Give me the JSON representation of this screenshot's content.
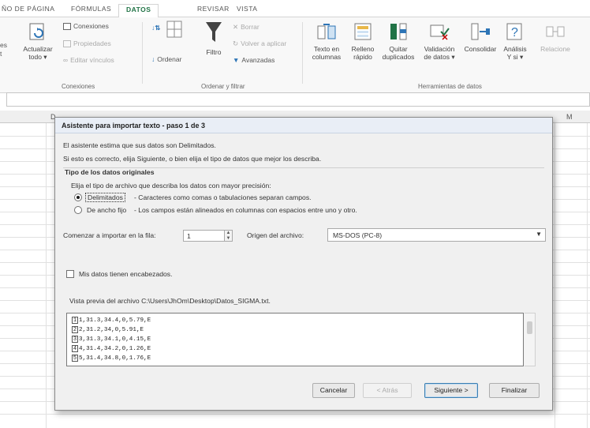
{
  "ribbon_tabs": [
    "ÑO DE PÁGINA",
    "FÓRMULAS",
    "DATOS",
    "REVISAR",
    "VISTA"
  ],
  "ribbon": {
    "edge_left": [
      "es",
      "t"
    ],
    "actualizar": "Actualizar",
    "actualizar_sub": "todo ▾",
    "conexiones": "Conexiones",
    "propiedades": "Propiedades",
    "editar_vinculos": "Editar vínculos",
    "ordenar": "Ordenar",
    "filtro": "Filtro",
    "borrar": "Borrar",
    "volver_aplicar": "Volver a aplicar",
    "avanzadas": "Avanzadas",
    "texto_columnas": [
      "Texto en",
      "columnas"
    ],
    "relleno_rapido": [
      "Relleno",
      "rápido"
    ],
    "quitar_duplicados": [
      "Quitar",
      "duplicados"
    ],
    "validacion_datos": [
      "Validación",
      "de datos ▾"
    ],
    "consolidar": "Consolidar",
    "analisis": [
      "Análisis",
      "Y si ▾"
    ],
    "relaciones": "Relacione",
    "group_conexiones": "Conexiones",
    "group_ordenar": "Ordenar y filtrar",
    "group_herramientas": "Herramientas de datos"
  },
  "sheet": {
    "col_d": "D",
    "col_m": "M"
  },
  "dialog": {
    "title": "Asistente para importar texto - paso 1 de 3",
    "line1": "El asistente estima que sus datos son Delimitados.",
    "line2": "Si esto es correcto, elija Siguiente, o bien elija el tipo de datos que mejor los describa.",
    "section_title": "Tipo de los datos originales",
    "section_prompt": "Elija el tipo de archivo que describa los datos con mayor precisión:",
    "opt_delimitados": "Delimitados",
    "opt_delimitados_desc": "- Caracteres como comas o tabulaciones separan campos.",
    "opt_ancho_fijo": "De ancho fijo",
    "opt_ancho_fijo_desc": "- Los campos están alineados en columnas con espacios entre uno y otro.",
    "start_row_label": "Comenzar a importar en la fila:",
    "start_row_value": "1",
    "origin_label": "Origen del archivo:",
    "origin_value": "MS-DOS (PC-8)",
    "headers_checkbox": "Mis datos tienen encabezados.",
    "preview_label": "Vista previa del archivo C:\\Users\\JhOm\\Desktop\\Datos_SIGMA.txt.",
    "preview_rows": [
      {
        "n": "1",
        "text": "1,31.3,34.4,0,5.79,E"
      },
      {
        "n": "2",
        "text": "2,31.2,34,0,5.91,E"
      },
      {
        "n": "3",
        "text": "3,31.3,34.1,0,4.15,E"
      },
      {
        "n": "4",
        "text": "4,31.4,34.2,0,1.26,E"
      },
      {
        "n": "5",
        "text": "5,31.4,34.8,0,1.76,E"
      }
    ],
    "btn_cancel": "Cancelar",
    "btn_back": "< Atrás",
    "btn_next": "Siguiente >",
    "btn_finish": "Finalizar"
  }
}
